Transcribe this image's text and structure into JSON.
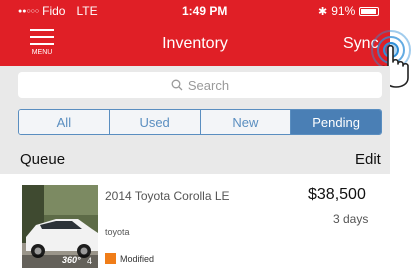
{
  "status_bar": {
    "carrier": "Fido",
    "network": "LTE",
    "time": "1:49 PM",
    "battery": "91%",
    "battery_level": 0.91
  },
  "nav": {
    "menu_label": "MENU",
    "title": "Inventory",
    "sync_label": "Sync"
  },
  "search": {
    "placeholder": "Search"
  },
  "segments": [
    {
      "label": "All",
      "active": false
    },
    {
      "label": "Used",
      "active": false
    },
    {
      "label": "New",
      "active": false
    },
    {
      "label": "Pending",
      "active": true
    }
  ],
  "section": {
    "title": "Queue",
    "edit_label": "Edit"
  },
  "item": {
    "title": "2014 Toyota Corolla LE",
    "make": "toyota",
    "status": "Modified",
    "price": "$38,500",
    "age": "3 days",
    "badge": "360°",
    "photo_count": "4"
  },
  "colors": {
    "brand_red": "#e01f26",
    "segment_blue": "#4a7fb5",
    "tap_blue": "#2f8fd8",
    "status_orange": "#f07d18"
  }
}
